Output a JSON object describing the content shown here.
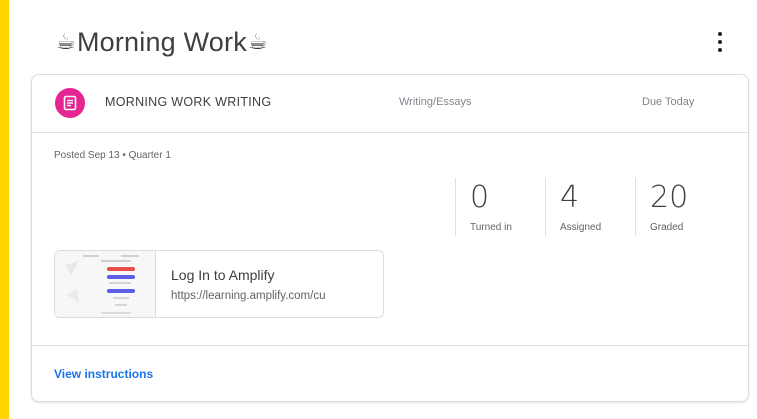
{
  "header": {
    "title": "Morning Work",
    "leading_icon": "coffee-icon",
    "trailing_icon": "coffee-icon",
    "menu_icon": "more-vert-icon"
  },
  "assignment": {
    "icon": "assignment-icon",
    "icon_color": "#E52592",
    "title": "MORNING WORK WRITING",
    "category": "Writing/Essays",
    "due": "Due Today",
    "posted": "Posted Sep 13 • Quarter 1",
    "stats": [
      {
        "value": "0",
        "label": "Turned in"
      },
      {
        "value": "4",
        "label": "Assigned"
      },
      {
        "value": "20",
        "label": "Graded"
      }
    ],
    "attachment": {
      "title": "Log In to Amplify",
      "url": "https://learning.amplify.com/cu"
    },
    "view_instructions": "View instructions"
  },
  "colors": {
    "background_border": "#FFD600",
    "link": "#1A73E8"
  }
}
